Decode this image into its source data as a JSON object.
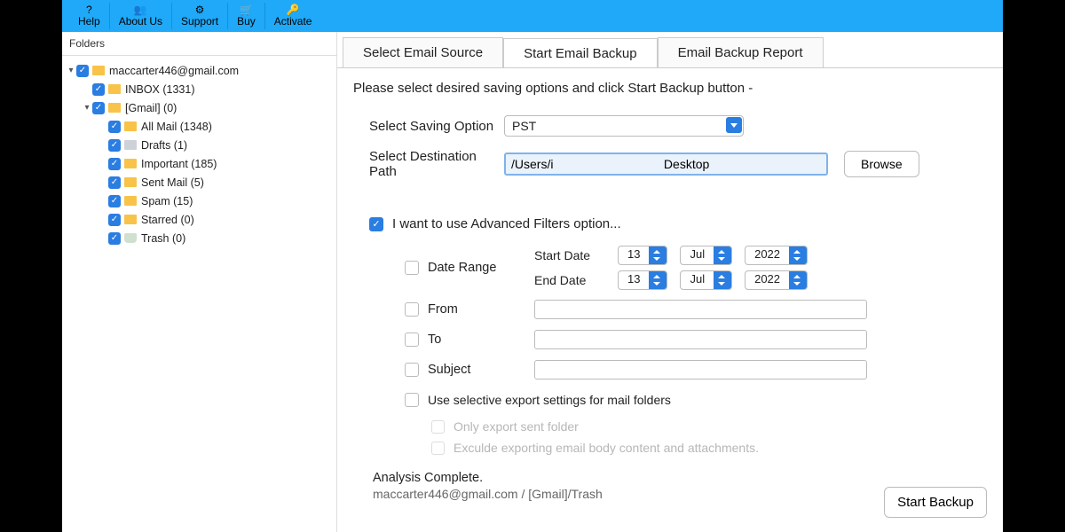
{
  "toolbar": {
    "items": [
      {
        "icon": "?",
        "label": "Help"
      },
      {
        "icon": "👥",
        "label": "About Us"
      },
      {
        "icon": "⚙",
        "label": "Support"
      },
      {
        "icon": "🛒",
        "label": "Buy"
      },
      {
        "icon": "🔑",
        "label": "Activate"
      }
    ]
  },
  "sidebar": {
    "header": "Folders",
    "root": "maccarter446@gmail.com",
    "inbox": "INBOX (1331)",
    "gmail": "[Gmail]  (0)",
    "children": [
      "All Mail (1348)",
      "Drafts (1)",
      "Important (185)",
      "Sent Mail (5)",
      "Spam (15)",
      "Starred (0)",
      "Trash (0)"
    ]
  },
  "tabs": {
    "t1": "Select Email Source",
    "t2": "Start Email Backup",
    "t3": "Email Backup Report"
  },
  "panel": {
    "instruction": "Please select desired saving options and click Start Backup button -",
    "saving_label": "Select Saving Option",
    "saving_value": "PST",
    "dest_label": "Select Destination Path",
    "dest_value": "/Users/i                                Desktop",
    "browse": "Browse",
    "advanced_label": "I want to use Advanced Filters option...",
    "filters": {
      "daterange": "Date Range",
      "start": "Start Date",
      "end": "End Date",
      "day": "13",
      "month": "Jul",
      "year": "2022",
      "from": "From",
      "to": "To",
      "subject": "Subject",
      "selective": "Use selective export settings for mail folders",
      "only_sent": "Only export sent folder",
      "exclude": "Exculde exporting email body content and attachments."
    },
    "status": "Analysis Complete.",
    "status_path": "maccarter446@gmail.com / [Gmail]/Trash",
    "start_backup": "Start Backup"
  }
}
